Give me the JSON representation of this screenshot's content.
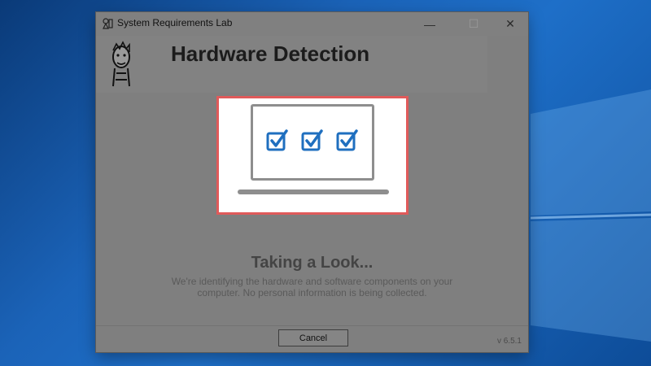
{
  "window": {
    "title": "System Requirements Lab",
    "minimize_glyph": "—",
    "maximize_glyph": "☐",
    "close_glyph": "✕"
  },
  "header": {
    "title": "Hardware Detection"
  },
  "illustration": {
    "icon": "laptop-with-three-checkboxes-icon",
    "checkbox_count": 3,
    "check_color": "#1f6fbf",
    "laptop_color": "#8e8e8e",
    "highlight_border_color": "#e05a5a"
  },
  "status": {
    "title": "Taking a Look...",
    "description": "We're identifying the hardware and software components on your computer. No personal information is being collected."
  },
  "footer": {
    "cancel_label": "Cancel",
    "version": "v 6.5.1"
  }
}
